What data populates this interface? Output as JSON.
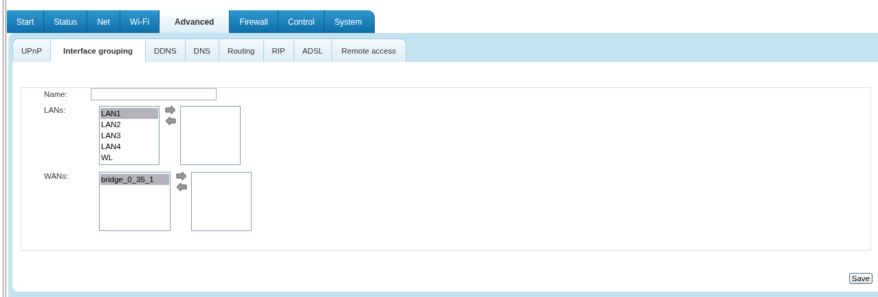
{
  "main_tabs": [
    {
      "label": "Start",
      "selected": false
    },
    {
      "label": "Status",
      "selected": false
    },
    {
      "label": "Net",
      "selected": false
    },
    {
      "label": "Wi-Fi",
      "selected": false
    },
    {
      "label": "Advanced",
      "selected": true
    },
    {
      "label": "Firewall",
      "selected": false
    },
    {
      "label": "Control",
      "selected": false
    },
    {
      "label": "System",
      "selected": false
    }
  ],
  "sub_tabs": [
    {
      "label": "UPnP",
      "selected": false
    },
    {
      "label": "Interface grouping",
      "selected": true
    },
    {
      "label": "DDNS",
      "selected": false
    },
    {
      "label": "DNS",
      "selected": false
    },
    {
      "label": "Routing",
      "selected": false
    },
    {
      "label": "RIP",
      "selected": false
    },
    {
      "label": "ADSL",
      "selected": false
    },
    {
      "label": "Remote access",
      "selected": false
    }
  ],
  "form": {
    "name": {
      "label": "Name:"
    },
    "groups": [
      {
        "label": "LANs:",
        "items": [
          {
            "label": "LAN1",
            "selected": true
          },
          {
            "label": "LAN2",
            "selected": false
          },
          {
            "label": "LAN3",
            "selected": false
          },
          {
            "label": "LAN4",
            "selected": false
          },
          {
            "label": "WL",
            "selected": false
          }
        ]
      },
      {
        "label": "WANs:",
        "items": [
          {
            "label": "bridge_0_35_1",
            "selected": true
          }
        ]
      }
    ]
  },
  "save_button": "Save"
}
